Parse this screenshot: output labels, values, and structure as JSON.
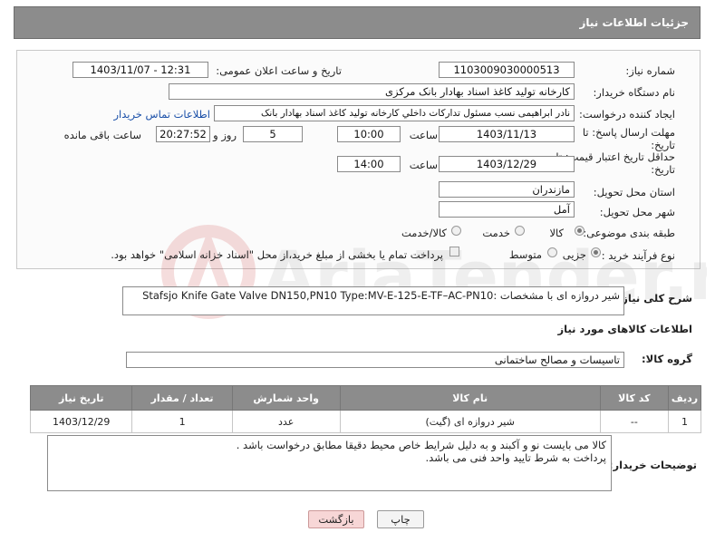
{
  "header": {
    "title": "جزئیات اطلاعات نیاز"
  },
  "labels": {
    "need_number": "شماره نیاز:",
    "announce_datetime": "تاریخ و ساعت اعلان عمومی:",
    "buyer_org": "نام دستگاه خریدار:",
    "requester": "ایجاد کننده درخواست:",
    "deadline": "مهلت ارسال پاسخ: تا",
    "deadline_2": "تاریخ:",
    "hour": "ساعت",
    "day_and": "روز و",
    "hours_remaining": "ساعت باقی مانده",
    "min_valid": "حداقل تاریخ اعتبار قیمت: تا",
    "min_valid_2": "تاریخ:",
    "province": "استان محل تحویل:",
    "city": "شهر محل تحویل:",
    "category": "طبقه بندی موضوعی:",
    "process": "نوع فرآیند خرید :",
    "general_desc": "شرح کلی نیاز:",
    "goods_info": "اطلاعات کالاهای مورد نیاز",
    "goods_group": "گروه کالا:",
    "buyer_notes": "توضیحات خریدار:"
  },
  "values": {
    "need_number": "1103009030000513",
    "announce_datetime": "1403/11/07 - 12:31",
    "buyer_org": "کارخانه تولید کاغذ اسناد بهادار بانک مرکزی",
    "requester": "نادر ابراهیمی نسب مسئول تداركات داخلي كارخانه توليد كاغذ اسناد بهادار بانک",
    "contact_link": "اطلاعات تماس خریدار",
    "deadline_date": "1403/11/13",
    "deadline_time": "10:00",
    "days": "5",
    "remaining": "20:27:52",
    "valid_date": "1403/12/29",
    "valid_time": "14:00",
    "province": "مازندران",
    "city": "آمل",
    "general_desc": "شیر دروازه ای با مشخصات :Stafsjo Knife Gate Valve DN150,PN10 Type:MV-E-125-E-TF–AC-PN10",
    "goods_group": "تاسیسات و مصالح ساختمانی",
    "buyer_notes_1": "کالا می بایست نو و آکبند و به دلیل شرایط خاص محیط دقیقا مطابق درخواست باشد .",
    "buyer_notes_2": "پرداخت به شرط تایید واحد فنی می باشد."
  },
  "category_options": [
    {
      "label": "کالا",
      "selected": true
    },
    {
      "label": "خدمت",
      "selected": false
    },
    {
      "label": "کالا/خدمت",
      "selected": false
    }
  ],
  "process_options": [
    {
      "label": "جزیی",
      "selected": true
    },
    {
      "label": "متوسط",
      "selected": false
    }
  ],
  "treasury_note": "پرداخت تمام یا بخشی از مبلغ خرید،از محل \"اسناد خزانه اسلامی\" خواهد بود.",
  "table": {
    "headers": [
      "ردیف",
      "کد کالا",
      "نام کالا",
      "واحد شمارش",
      "تعداد / مقدار",
      "تاریخ نیاز"
    ],
    "rows": [
      [
        "1",
        "--",
        "شیر دروازه ای (گیت)",
        "عدد",
        "1",
        "1403/12/29"
      ]
    ]
  },
  "buttons": {
    "print": "چاپ",
    "back": "بازگشت"
  },
  "watermark_text": "AriaTender.net",
  "colors": {
    "header_bg": "#8c8c8c",
    "link": "#1a4fa8",
    "back_btn": "#f7d6d6"
  }
}
